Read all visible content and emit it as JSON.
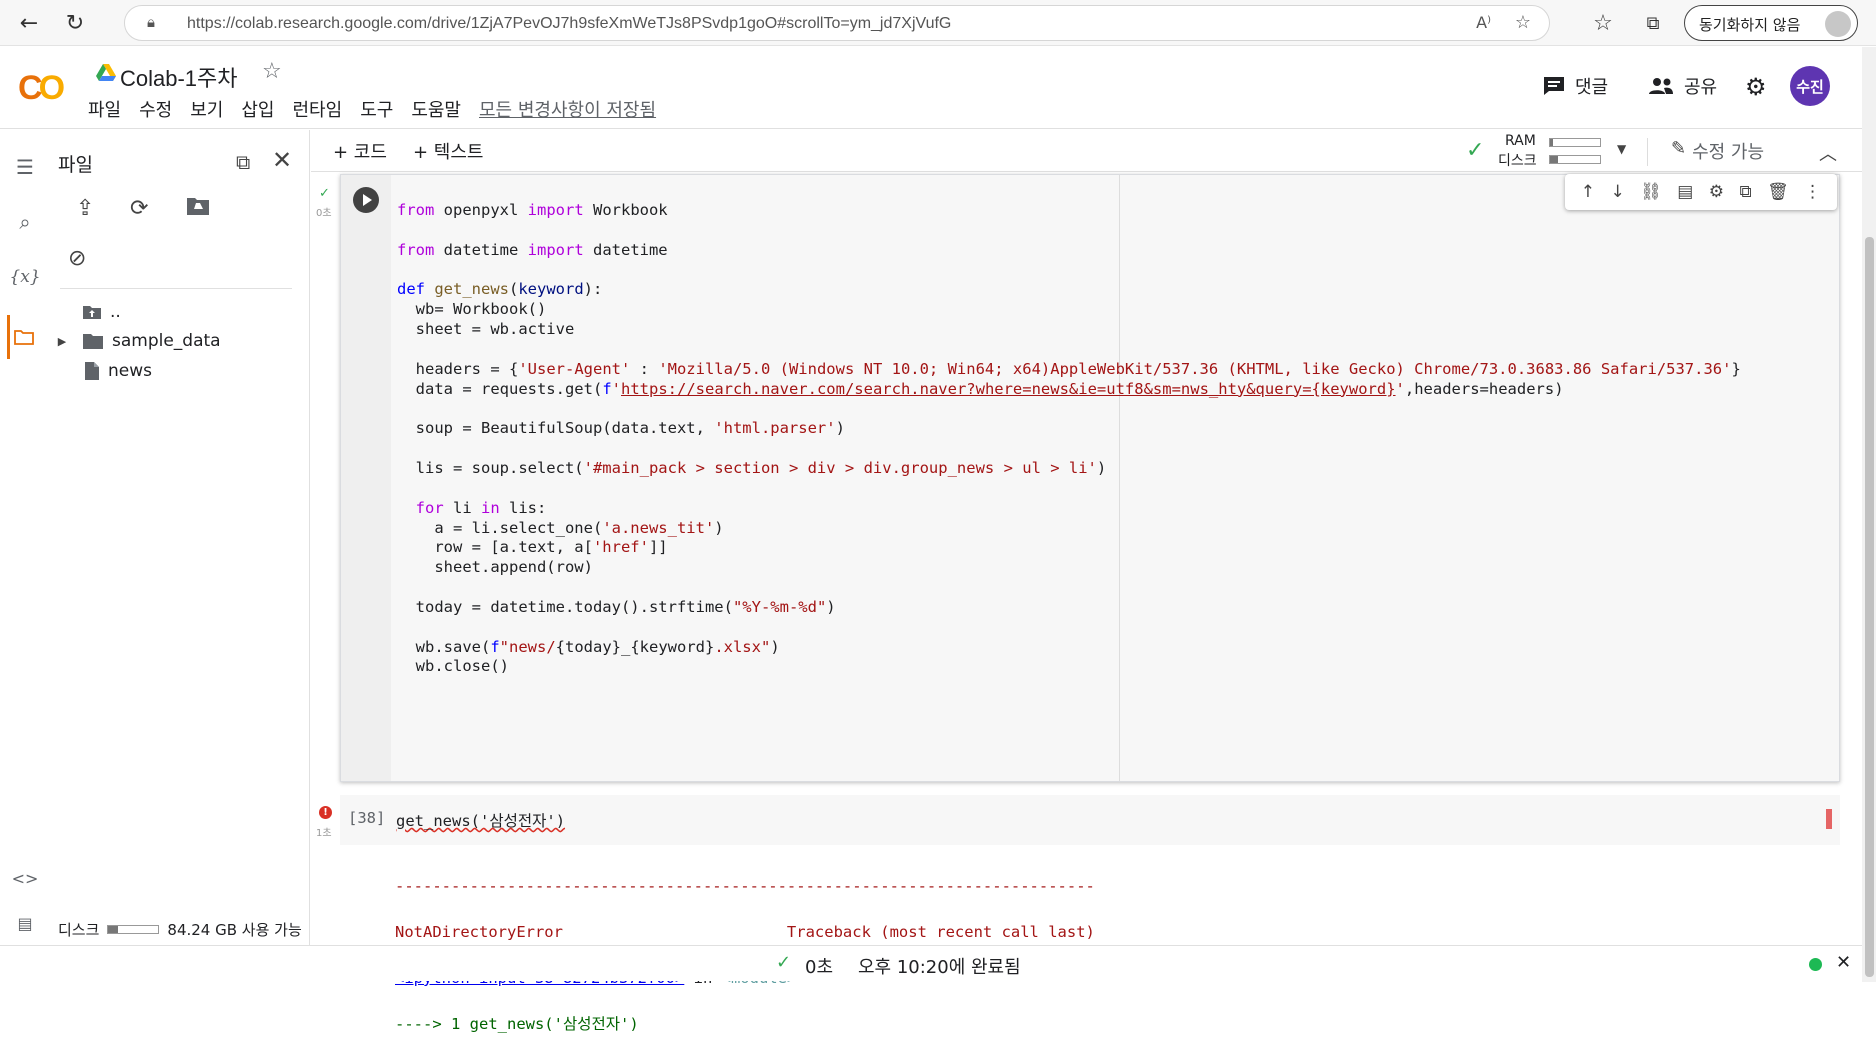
{
  "browser": {
    "url": "https://colab.research.google.com/drive/1ZjA7PevOJ7h9sfeXmWeTJs8PSvdp1goO#scrollTo=ym_jd7XjVufG",
    "sync_button": "동기화하지 않음"
  },
  "header": {
    "notebook_title": "Colab-1주차",
    "menu": [
      "파일",
      "수정",
      "보기",
      "삽입",
      "런타임",
      "도구",
      "도움말"
    ],
    "save_status": "모든 변경사항이 저장됨",
    "comment_label": "댓글",
    "share_label": "공유",
    "user_initials": "수진"
  },
  "files_panel": {
    "title": "파일",
    "items": [
      {
        "name": "..",
        "type": "parent"
      },
      {
        "name": "sample_data",
        "type": "folder"
      },
      {
        "name": "news",
        "type": "file"
      }
    ],
    "disk_label": "디스크",
    "disk_available": "84.24 GB 사용 가능"
  },
  "toolbar": {
    "add_code": "+ 코드",
    "add_text": "+ 텍스트",
    "ram_label": "RAM",
    "disk_label": "디스크",
    "edit_mode": "수정 가능"
  },
  "cell1": {
    "exec_time": "0초",
    "code": [
      [
        [
          "kw",
          "from"
        ],
        [
          "",
          " openpyxl "
        ],
        [
          "kw",
          "import"
        ],
        [
          "",
          " Workbook"
        ]
      ],
      [],
      [
        [
          "kw",
          "from"
        ],
        [
          "",
          " datetime "
        ],
        [
          "kw",
          "import"
        ],
        [
          "",
          " datetime"
        ]
      ],
      [],
      [
        [
          "kb",
          "def"
        ],
        [
          "",
          " "
        ],
        [
          "fn",
          "get_news"
        ],
        [
          "",
          "("
        ],
        [
          "pr",
          "keyword"
        ],
        [
          "",
          "):"
        ]
      ],
      [
        [
          "",
          "  wb= Workbook()"
        ]
      ],
      [
        [
          "",
          "  sheet = wb.active"
        ]
      ],
      [],
      [
        [
          "",
          "  headers = {"
        ],
        [
          "st",
          "'User-Agent'"
        ],
        [
          "",
          " : "
        ],
        [
          "st",
          "'Mozilla/5.0 (Windows NT 10.0; Win64; x64)AppleWebKit/537.36 (KHTML, like Gecko) Chrome/73.0.3683.86 Safari/537.36'"
        ],
        [
          "",
          "}"
        ]
      ],
      [
        [
          "",
          "  data = requests.get("
        ],
        [
          "kb",
          "f"
        ],
        [
          "st",
          "'"
        ],
        [
          "ul",
          "https://search.naver.com/search.naver?where=news&ie=utf8&sm=nws_hty&query={keyword}"
        ],
        [
          "st",
          "'"
        ],
        [
          "",
          ",headers=headers)"
        ]
      ],
      [],
      [
        [
          "",
          "  soup = BeautifulSoup(data.text, "
        ],
        [
          "st",
          "'html.parser'"
        ],
        [
          "",
          ")"
        ]
      ],
      [],
      [
        [
          "",
          "  lis = soup.select("
        ],
        [
          "st",
          "'#main_pack > section > div > div.group_news > ul > li'"
        ],
        [
          "",
          ")"
        ]
      ],
      [],
      [
        [
          "",
          "  "
        ],
        [
          "kw",
          "for"
        ],
        [
          "",
          " li "
        ],
        [
          "kw",
          "in"
        ],
        [
          "",
          " lis:"
        ]
      ],
      [
        [
          "",
          "    a = li.select_one("
        ],
        [
          "st",
          "'a.news_tit'"
        ],
        [
          "",
          ")"
        ]
      ],
      [
        [
          "",
          "    row = [a.text, a["
        ],
        [
          "st",
          "'href'"
        ],
        [
          "",
          "]]"
        ]
      ],
      [
        [
          "",
          "    sheet.append(row)"
        ]
      ],
      [],
      [
        [
          "",
          "  today = datetime.today().strftime("
        ],
        [
          "st",
          "\"%Y-%m-%d\""
        ],
        [
          "",
          ")"
        ]
      ],
      [],
      [
        [
          "",
          "  wb.save("
        ],
        [
          "kb",
          "f"
        ],
        [
          "st",
          "\"news/"
        ],
        [
          "",
          "{today}_{keyword}"
        ],
        [
          "st",
          ".xlsx\""
        ],
        [
          "",
          ")"
        ]
      ],
      [
        [
          "",
          "  wb.close()"
        ]
      ]
    ]
  },
  "cell2": {
    "exec_count": "[38]",
    "exec_time": "1초",
    "code": "get_news('삼성전자')"
  },
  "output": {
    "separator": "---------------------------------------------------------------------------",
    "error_line": "NotADirectoryError                        Traceback (most recent call last)",
    "input_ref": "<ipython-input-38-82724b372f00>",
    "in_text": " in ",
    "module": "<module>",
    "arrow_line": "----> 1 get_news('삼성전자')"
  },
  "footer": {
    "time": "0초",
    "status": "오후 10:20에 완료됨"
  },
  "colors": {
    "accent": "#e8710a",
    "user": "#5e35b1",
    "success": "#34a853",
    "error": "#d93025"
  }
}
